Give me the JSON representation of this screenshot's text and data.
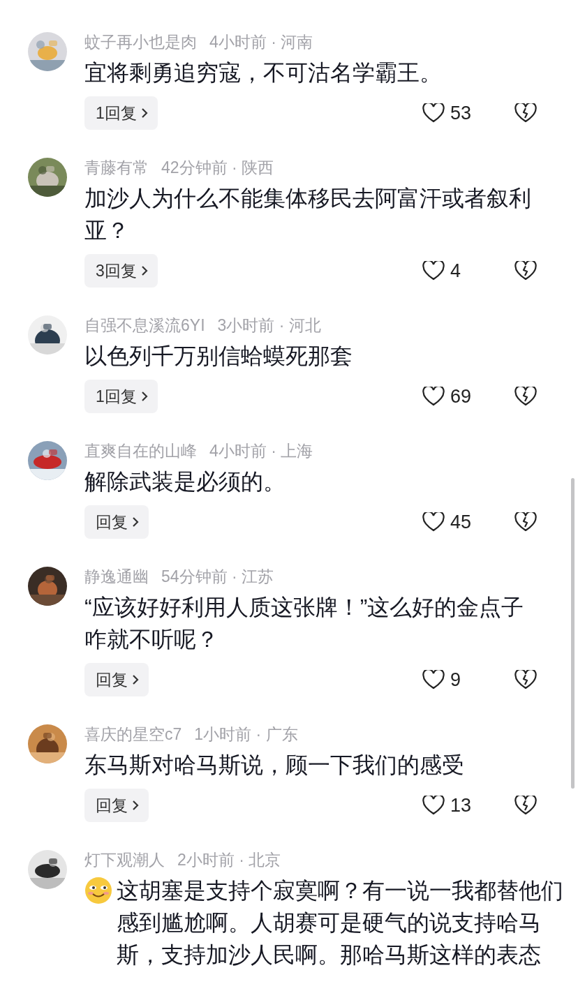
{
  "comments": [
    {
      "username": "蚊子再小也是肉",
      "time_location": "4小时前 · 河南",
      "has_emoji": false,
      "text": "宜将剩勇追穷寇，不可沽名学霸王。",
      "reply_label": "1回复",
      "likes": "53"
    },
    {
      "username": "青藤有常",
      "time_location": "42分钟前 · 陕西",
      "has_emoji": false,
      "text": "加沙人为什么不能集体移民去阿富汗或者叙利亚？",
      "reply_label": "3回复",
      "likes": "4"
    },
    {
      "username": "自强不息溪流6YI",
      "time_location": "3小时前 · 河北",
      "has_emoji": false,
      "text": "以色列千万别信蛤蟆死那套",
      "reply_label": "1回复",
      "likes": "69"
    },
    {
      "username": "直爽自在的山峰",
      "time_location": "4小时前 · 上海",
      "has_emoji": false,
      "text": "解除武装是必须的。",
      "reply_label": "回复",
      "likes": "45"
    },
    {
      "username": "静逸通幽",
      "time_location": "54分钟前 · 江苏",
      "has_emoji": false,
      "text": "“应该好好利用人质这张牌！”这么好的金点子咋就不听呢？",
      "reply_label": "回复",
      "likes": "9"
    },
    {
      "username": "喜庆的星空c7",
      "time_location": "1小时前 · 广东",
      "has_emoji": false,
      "text": "东马斯对哈马斯说，顾一下我们的感受",
      "reply_label": "回复",
      "likes": "13"
    },
    {
      "username": "灯下观潮人",
      "time_location": "2小时前 · 北京",
      "has_emoji": true,
      "text": "这胡塞是支持个寂寞啊？有一说一我都替他们感到尴尬啊。人胡赛可是硬气的说支持哈马斯，支持加沙人民啊。那哈马斯这样的表态"
    }
  ]
}
